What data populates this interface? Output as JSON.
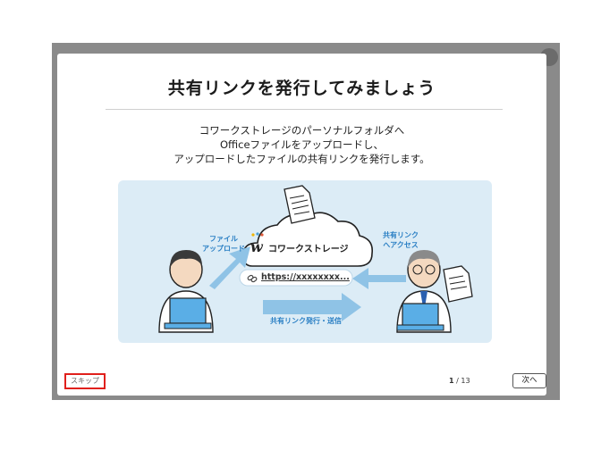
{
  "modal": {
    "title": "共有リンクを発行してみましょう",
    "description": [
      "コワークストレージのパーソナルフォルダへ",
      "Officeファイルをアップロードし、",
      "アップロードしたファイルの共有リンクを発行します。"
    ]
  },
  "illustration": {
    "label_upload": [
      "ファイル",
      "アップロード"
    ],
    "label_access": [
      "共有リンク",
      "へアクセス"
    ],
    "label_issue": "共有リンク発行・送信",
    "brand_name": "コワークストレージ",
    "url_text": "https://xxxxxxxx..."
  },
  "footer": {
    "skip_label": "スキップ",
    "page_current": "1",
    "page_total": "13",
    "next_label": "次へ"
  },
  "colors": {
    "illustration_bg": "#dcecf6",
    "accent_blue": "#2a7fc4",
    "arrow_blue": "#8fc3e6",
    "skip_highlight": "#e0201c"
  }
}
